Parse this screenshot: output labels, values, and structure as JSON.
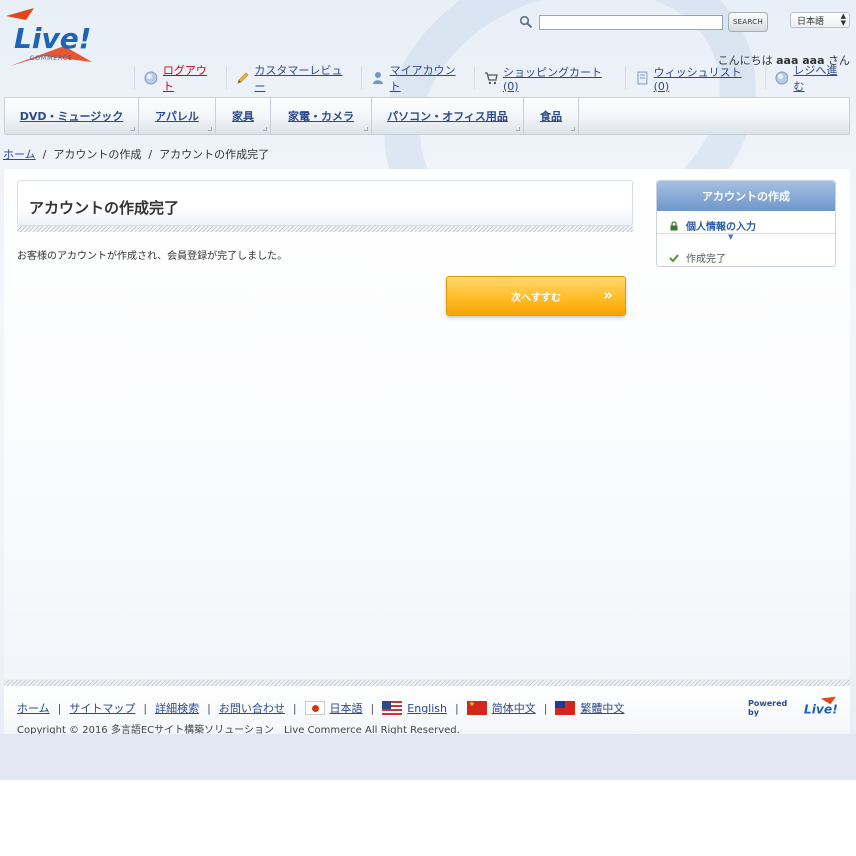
{
  "brand": {
    "logo_text": "Live!",
    "logo_sub": "COMMERCE"
  },
  "search": {
    "placeholder": "",
    "button_label": "SEARCH"
  },
  "language_select": {
    "selected": "日本語"
  },
  "greeting": {
    "prefix": "こんにちは",
    "user": "aaa aaa",
    "suffix": "さん"
  },
  "topnav": {
    "logout": "ログアウト",
    "reviews": "カスタマーレビュー",
    "my_account": "マイアカウント",
    "cart": "ショッピングカート(0)",
    "wishlist": "ウィッシュリスト(0)",
    "checkout": "レジへ進む"
  },
  "categories": [
    "DVD・ミュージック",
    "アパレル",
    "家具",
    "家電・カメラ",
    "パソコン・オフィス用品",
    "食品"
  ],
  "breadcrumb": {
    "home": "ホーム",
    "step1": "アカウントの作成",
    "step2": "アカウントの作成完了",
    "separator": "/"
  },
  "main": {
    "title": "アカウントの作成完了",
    "message": "お客様のアカウントが作成され、会員登録が完了しました。",
    "next_button": "次へすすむ"
  },
  "sidebar": {
    "title": "アカウントの作成",
    "steps": [
      {
        "label": "個人情報の入力",
        "active": true
      },
      {
        "label": "作成完了",
        "active": false
      }
    ]
  },
  "footer": {
    "links": {
      "home": "ホーム",
      "sitemap": "サイトマップ",
      "advanced_search": "詳細検索",
      "contact": "お問い合わせ"
    },
    "languages": {
      "ja": "日本語",
      "en": "English",
      "zh_cn": "简体中文",
      "zh_tw": "繁體中文"
    },
    "copyright": "Copyright © 2016 多言語ECサイト構築ソリューション　Live Commerce All Right Reserved.",
    "powered_by": "Powered by",
    "powered_logo": "Live!"
  },
  "colors": {
    "link": "#2d4b8a",
    "logout_link": "#d0021b",
    "accent_button": "#ffc02c",
    "sidebar_head": "#6f97cb"
  }
}
